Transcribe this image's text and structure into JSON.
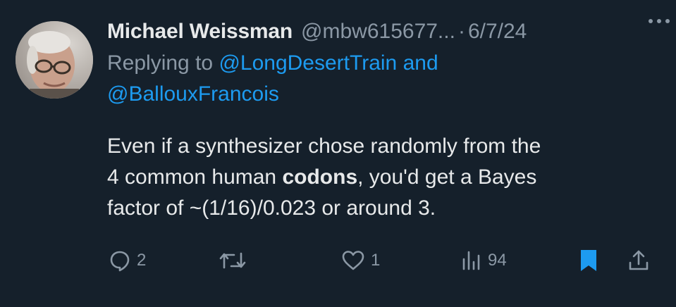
{
  "author": {
    "name": "Michael Weissman",
    "handle": "@mbw615677...",
    "separator": "·",
    "date": "6/7/24"
  },
  "reply": {
    "prefix": "Replying to",
    "mention1": "@LongDesertTrain",
    "conjunction": "and",
    "mention2": "@BallouxFrancois"
  },
  "tweet": {
    "line1": "Even if a synthesizer chose randomly from the",
    "line2_pre": "4 common human ",
    "line2_bold": "codons",
    "line2_post": ", you'd get a Bayes",
    "line3": "factor of ~(1/16)/0.023 or around 3."
  },
  "actions": {
    "replies": "2",
    "likes": "1",
    "views": "94"
  },
  "icons": {
    "reply": "speech-bubble-icon",
    "retweet": "retweet-icon",
    "like": "heart-icon",
    "views": "bar-chart-icon",
    "bookmark": "bookmark-icon",
    "share": "share-icon",
    "more": "more-dots-icon"
  },
  "colors": {
    "background": "#15202b",
    "text": "#e7e9ea",
    "muted": "#8b98a5",
    "accent": "#1d9bf0"
  }
}
